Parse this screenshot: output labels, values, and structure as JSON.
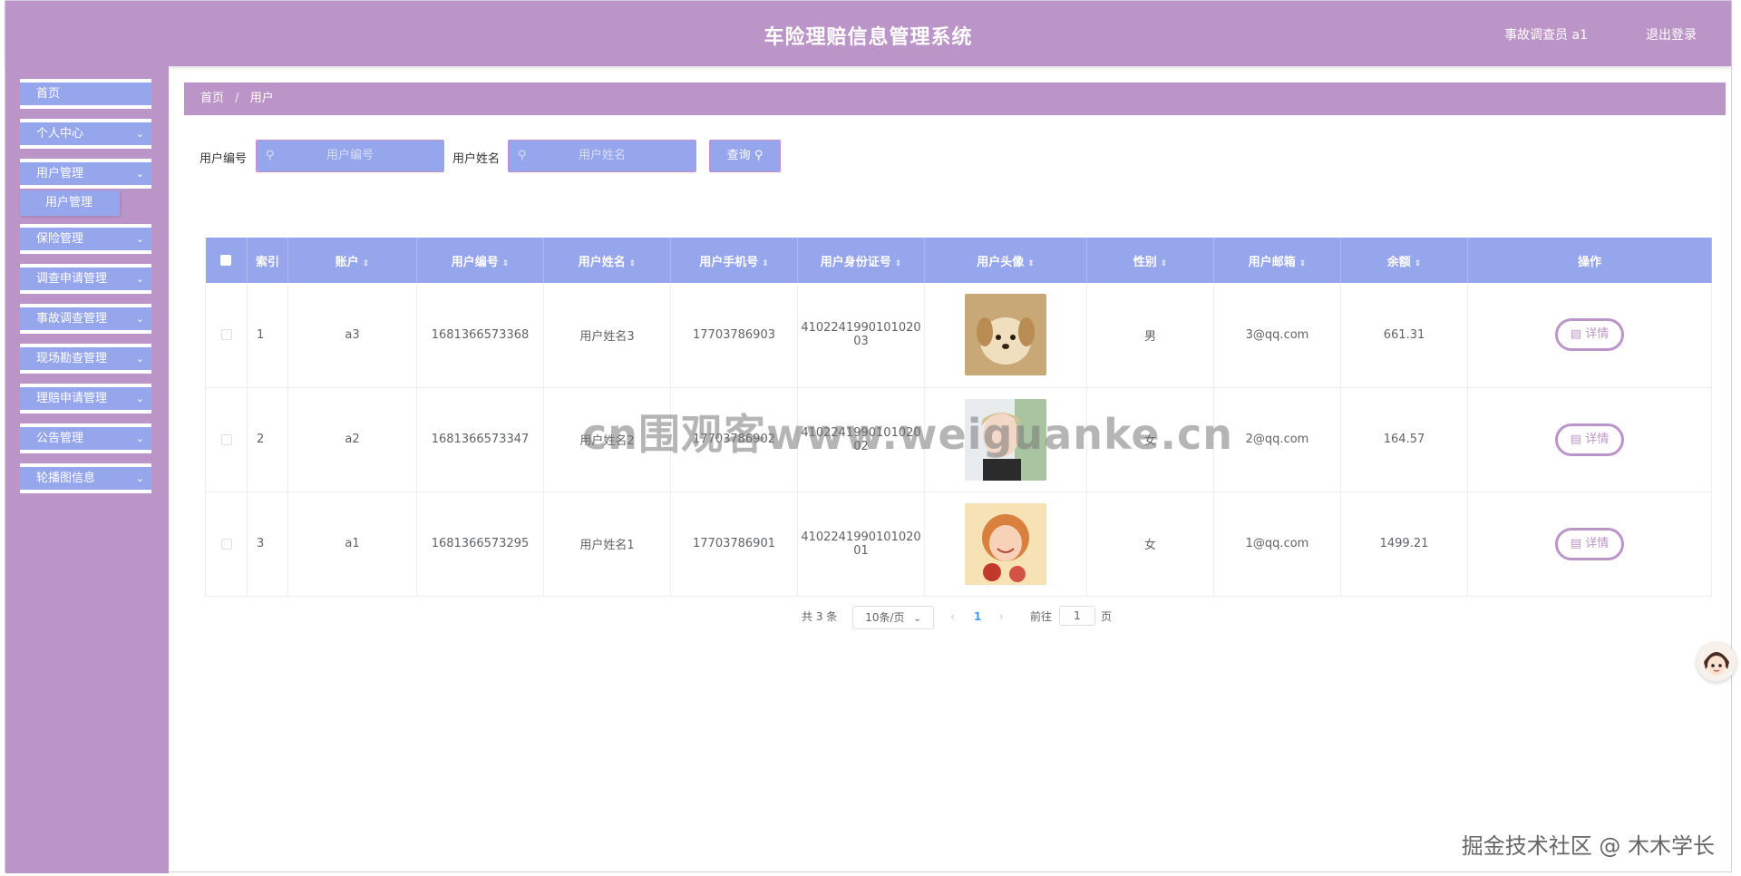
{
  "app": {
    "title": "车险理赔信息管理系统",
    "user": "事故调查员 a1",
    "logout": "退出登录"
  },
  "sidebar": {
    "items": [
      {
        "label": "首页",
        "has_chevron": false
      },
      {
        "label": "个人中心",
        "has_chevron": true
      },
      {
        "label": "用户管理",
        "has_chevron": true
      },
      {
        "label": "保险管理",
        "has_chevron": true
      },
      {
        "label": "调查申请管理",
        "has_chevron": true
      },
      {
        "label": "事故调查管理",
        "has_chevron": true
      },
      {
        "label": "现场勘查管理",
        "has_chevron": true
      },
      {
        "label": "理赔申请管理",
        "has_chevron": true
      },
      {
        "label": "公告管理",
        "has_chevron": true
      },
      {
        "label": "轮播图信息",
        "has_chevron": true
      }
    ],
    "subitem": "用户管理"
  },
  "breadcrumb": {
    "home": "首页",
    "current": "用户"
  },
  "search": {
    "label_id": "用户编号",
    "placeholder_id": "用户编号",
    "label_name": "用户姓名",
    "placeholder_name": "用户姓名",
    "button": "查询"
  },
  "table": {
    "headers": [
      "索引",
      "账户",
      "用户编号",
      "用户姓名",
      "用户手机号",
      "用户身份证号",
      "用户头像",
      "性别",
      "用户邮箱",
      "余额",
      "操作"
    ],
    "rows": [
      {
        "index": "1",
        "account": "a3",
        "user_id": "1681366573368",
        "name": "用户姓名3",
        "phone": "17703786903",
        "id_card_1": "4102241990101020",
        "id_card_2": "03",
        "avatar": "puppy",
        "gender": "男",
        "email": "3@qq.com",
        "balance": "661.31",
        "action": "详情"
      },
      {
        "index": "2",
        "account": "a2",
        "user_id": "1681366573347",
        "name": "用户姓名2",
        "phone": "17703786902",
        "id_card_1": "4102241990101020",
        "id_card_2": "02",
        "avatar": "person-light",
        "gender": "女",
        "email": "2@qq.com",
        "balance": "164.57",
        "action": "详情"
      },
      {
        "index": "3",
        "account": "a1",
        "user_id": "1681366573295",
        "name": "用户姓名1",
        "phone": "17703786901",
        "id_card_1": "4102241990101020",
        "id_card_2": "01",
        "avatar": "person-warm",
        "gender": "女",
        "email": "1@qq.com",
        "balance": "1499.21",
        "action": "详情"
      }
    ]
  },
  "pagination": {
    "total": "共 3 条",
    "page_size": "10条/页",
    "current": "1",
    "goto_prefix": "前往",
    "goto_value": "1",
    "goto_suffix": "页"
  },
  "watermark": "cn围观客www.weiguanke.cn",
  "footer": "掘金技术社区 @ 木木学长",
  "colors": {
    "purple": "#bc95c8",
    "blue": "#96a6ec",
    "page_active": "#409eff"
  }
}
